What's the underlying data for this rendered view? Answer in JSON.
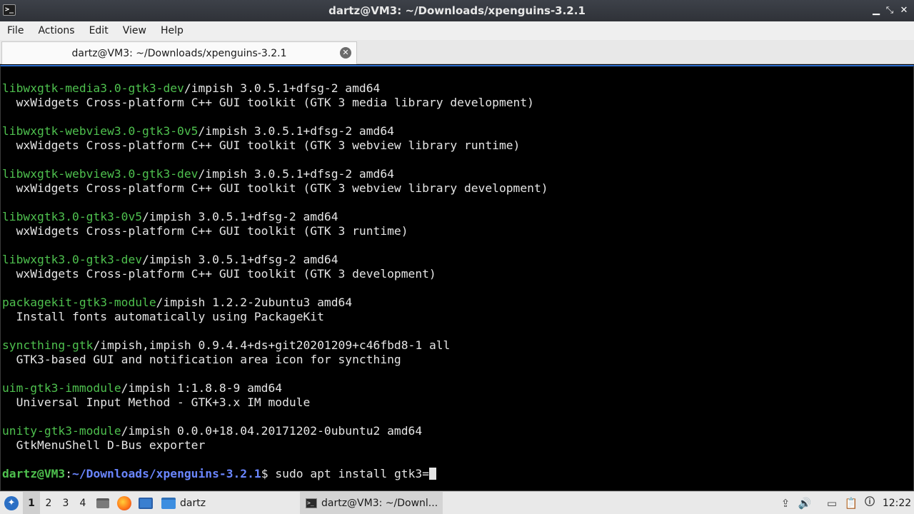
{
  "window": {
    "title": "dartz@VM3: ~/Downloads/xpenguins-3.2.1",
    "controls": [
      "minimize",
      "maximize",
      "close"
    ]
  },
  "menubar": {
    "items": [
      "File",
      "Actions",
      "Edit",
      "View",
      "Help"
    ]
  },
  "tabs": [
    {
      "label": "dartz@VM3: ~/Downloads/xpenguins-3.2.1",
      "active": true
    }
  ],
  "terminal": {
    "entries": [
      {
        "pkg": "libwxgtk-media3.0-gtk3-dev",
        "info": "/impish 3.0.5.1+dfsg-2 amd64",
        "desc": "  wxWidgets Cross-platform C++ GUI toolkit (GTK 3 media library development)"
      },
      {
        "pkg": "libwxgtk-webview3.0-gtk3-0v5",
        "info": "/impish 3.0.5.1+dfsg-2 amd64",
        "desc": "  wxWidgets Cross-platform C++ GUI toolkit (GTK 3 webview library runtime)"
      },
      {
        "pkg": "libwxgtk-webview3.0-gtk3-dev",
        "info": "/impish 3.0.5.1+dfsg-2 amd64",
        "desc": "  wxWidgets Cross-platform C++ GUI toolkit (GTK 3 webview library development)"
      },
      {
        "pkg": "libwxgtk3.0-gtk3-0v5",
        "info": "/impish 3.0.5.1+dfsg-2 amd64",
        "desc": "  wxWidgets Cross-platform C++ GUI toolkit (GTK 3 runtime)"
      },
      {
        "pkg": "libwxgtk3.0-gtk3-dev",
        "info": "/impish 3.0.5.1+dfsg-2 amd64",
        "desc": "  wxWidgets Cross-platform C++ GUI toolkit (GTK 3 development)"
      },
      {
        "pkg": "packagekit-gtk3-module",
        "info": "/impish 1.2.2-2ubuntu3 amd64",
        "desc": "  Install fonts automatically using PackageKit"
      },
      {
        "pkg": "syncthing-gtk",
        "info": "/impish,impish 0.9.4.4+ds+git20201209+c46fbd8-1 all",
        "desc": "  GTK3-based GUI and notification area icon for syncthing"
      },
      {
        "pkg": "uim-gtk3-immodule",
        "info": "/impish 1:1.8.8-9 amd64",
        "desc": "  Universal Input Method - GTK+3.x IM module"
      },
      {
        "pkg": "unity-gtk3-module",
        "info": "/impish 0.0.0+18.04.20171202-0ubuntu2 amd64",
        "desc": "  GtkMenuShell D-Bus exporter"
      }
    ],
    "prompt": {
      "user": "dartz@VM3",
      "sep": ":",
      "path": "~/Downloads/xpenguins-3.2.1",
      "symbol": "$",
      "command": " sudo apt install gtk3="
    }
  },
  "taskbar": {
    "workspaces": [
      "1",
      "2",
      "3",
      "4"
    ],
    "active_workspace": "1",
    "folder_task": "dartz",
    "terminal_task": "dartz@VM3: ~/Downl...",
    "clock": "12:22"
  },
  "colors": {
    "package_name": "#4ec04e",
    "prompt_path": "#6a86ff",
    "terminal_bg": "#000000",
    "focus_border": "#2f70d0"
  }
}
